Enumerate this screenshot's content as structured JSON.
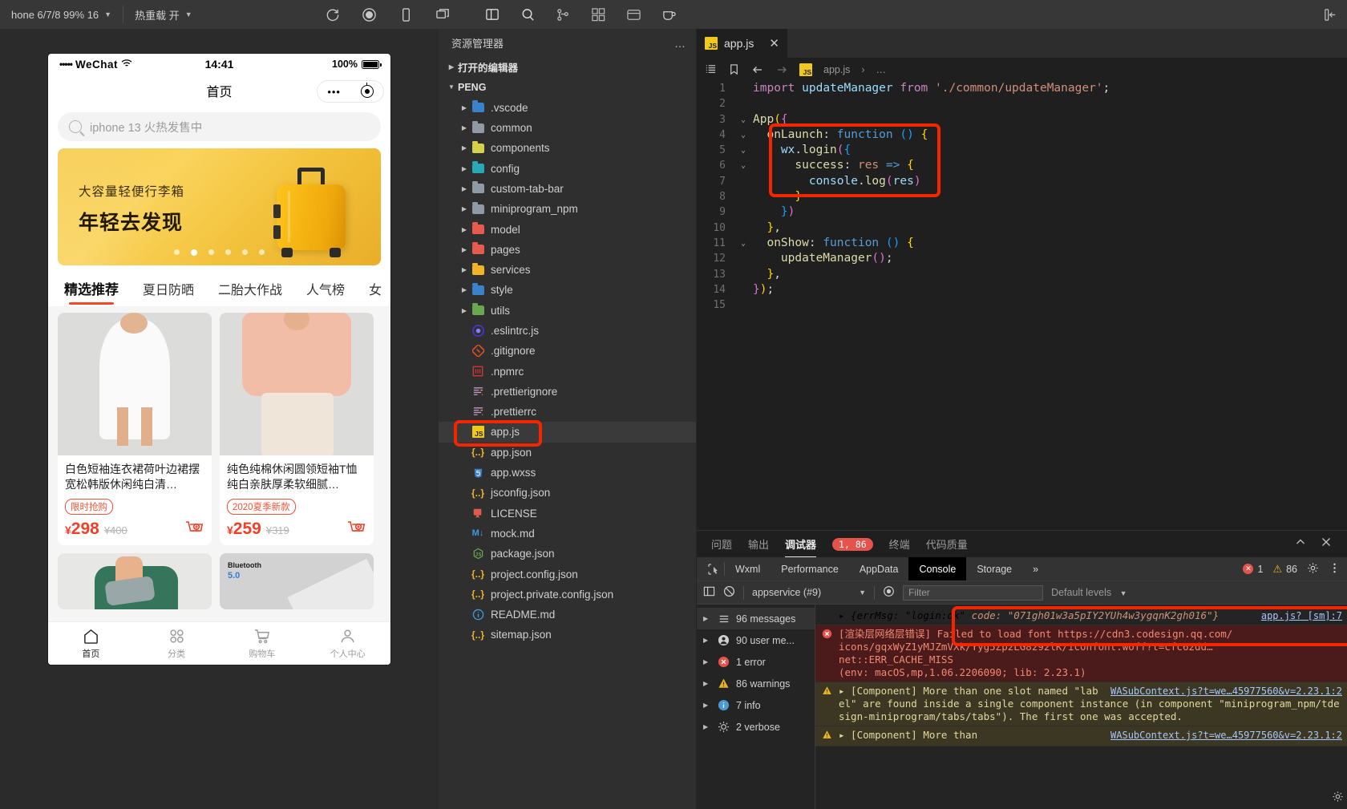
{
  "toolbar": {
    "device_label": "hone 6/7/8 99% 16",
    "hotreload_label": "热重载 开",
    "icons": [
      "refresh-icon",
      "record-icon",
      "phone-icon",
      "copy-window-icon",
      "split-layout-icon",
      "search-icon",
      "source-control-icon",
      "extensions-icon",
      "cloud-icon",
      "coffee-icon",
      "collapse-sidebar-icon"
    ]
  },
  "simulator": {
    "status_bar": {
      "carrier_dots": "•••••",
      "carrier": "WeChat",
      "wifi": "wifi-icon",
      "time": "14:41",
      "battery_pct": "100%"
    },
    "nav_title": "首页",
    "capsule": {
      "more": "•••",
      "target": "target-icon"
    },
    "search_placeholder": "iphone 13 火热发售中",
    "banner": {
      "subtitle": "大容量轻便行李箱",
      "title": "年轻去发现",
      "dot_count": 6,
      "active_dot": 1
    },
    "tabs": [
      {
        "label": "精选推荐",
        "active": true
      },
      {
        "label": "夏日防晒",
        "active": false
      },
      {
        "label": "二胎大作战",
        "active": false
      },
      {
        "label": "人气榜",
        "active": false
      },
      {
        "label": "女",
        "active": false
      }
    ],
    "products": [
      {
        "title": "白色短袖连衣裙荷叶边裙摆宽松韩版休闲纯白清…",
        "badge": "限时抢购",
        "price": "298",
        "old_price": "¥400",
        "currency": "¥"
      },
      {
        "title": "纯色纯棉休闲圆领短袖T恤纯白亲肤厚柔软细腻…",
        "badge": "2020夏季新款",
        "price": "259",
        "old_price": "¥319",
        "currency": "¥"
      }
    ],
    "second_row": {
      "bluetooth_label": "Bluetooth",
      "bluetooth_version": "5.0"
    },
    "tabbar": [
      {
        "label": "首页",
        "icon": "home-icon",
        "active": true
      },
      {
        "label": "分类",
        "icon": "grid-icon",
        "active": false
      },
      {
        "label": "购物车",
        "icon": "cart-icon",
        "active": false
      },
      {
        "label": "个人中心",
        "icon": "user-icon",
        "active": false
      }
    ]
  },
  "explorer": {
    "title": "资源管理器",
    "more": "…",
    "sections": [
      {
        "label": "打开的编辑器",
        "expanded": false
      },
      {
        "label": "PENG",
        "expanded": true
      }
    ],
    "items": [
      {
        "name": ".vscode",
        "type": "folder",
        "icon": "vscode-folder-icon",
        "color": "#3b82cd",
        "expandable": true,
        "selected": false
      },
      {
        "name": "common",
        "type": "folder",
        "icon": "folder-icon",
        "color": "#8f9aa3",
        "expandable": true,
        "selected": false
      },
      {
        "name": "components",
        "type": "folder",
        "icon": "components-folder-icon",
        "color": "#d6d14a",
        "expandable": true,
        "selected": false
      },
      {
        "name": "config",
        "type": "folder",
        "icon": "config-folder-icon",
        "color": "#2aa8b5",
        "expandable": true,
        "selected": false
      },
      {
        "name": "custom-tab-bar",
        "type": "folder",
        "icon": "folder-icon",
        "color": "#8f9aa3",
        "expandable": true,
        "selected": false
      },
      {
        "name": "miniprogram_npm",
        "type": "folder",
        "icon": "folder-icon",
        "color": "#8f9aa3",
        "expandable": true,
        "selected": false
      },
      {
        "name": "model",
        "type": "folder",
        "icon": "model-folder-icon",
        "color": "#e55b4d",
        "expandable": true,
        "selected": false
      },
      {
        "name": "pages",
        "type": "folder",
        "icon": "pages-folder-icon",
        "color": "#e55b4d",
        "expandable": true,
        "selected": false
      },
      {
        "name": "services",
        "type": "folder",
        "icon": "services-folder-icon",
        "color": "#f0b429",
        "expandable": true,
        "selected": false
      },
      {
        "name": "style",
        "type": "folder",
        "icon": "style-folder-icon",
        "color": "#3b82cd",
        "expandable": true,
        "selected": false
      },
      {
        "name": "utils",
        "type": "folder",
        "icon": "utils-folder-icon",
        "color": "#6aa84f",
        "expandable": true,
        "selected": false
      },
      {
        "name": ".eslintrc.js",
        "type": "file",
        "icon": "eslint-icon",
        "color": "#4b32c3",
        "expandable": false,
        "selected": false
      },
      {
        "name": ".gitignore",
        "type": "file",
        "icon": "git-icon",
        "color": "#e8521f",
        "expandable": false,
        "selected": false
      },
      {
        "name": ".npmrc",
        "type": "file",
        "icon": "npm-icon",
        "color": "#cb3837",
        "expandable": false,
        "selected": false
      },
      {
        "name": ".prettierignore",
        "type": "file",
        "icon": "prettier-icon",
        "color": "#c596c7",
        "expandable": false,
        "selected": false
      },
      {
        "name": ".prettierrc",
        "type": "file",
        "icon": "prettier-icon",
        "color": "#c596c7",
        "expandable": false,
        "selected": false
      },
      {
        "name": "app.js",
        "type": "file",
        "icon": "js-icon",
        "color": "#f2c91b",
        "expandable": false,
        "selected": true,
        "highlighted": true
      },
      {
        "name": "app.json",
        "type": "file",
        "icon": "json-icon",
        "color": "#f0b429",
        "expandable": false,
        "selected": false
      },
      {
        "name": "app.wxss",
        "type": "file",
        "icon": "css-icon",
        "color": "#3b82cd",
        "expandable": false,
        "selected": false
      },
      {
        "name": "jsconfig.json",
        "type": "file",
        "icon": "json-icon",
        "color": "#f0b429",
        "expandable": false,
        "selected": false
      },
      {
        "name": "LICENSE",
        "type": "file",
        "icon": "license-icon",
        "color": "#e05b49",
        "expandable": false,
        "selected": false
      },
      {
        "name": "mock.md",
        "type": "file",
        "icon": "markdown-icon",
        "color": "#3b9ddd",
        "expandable": false,
        "selected": false
      },
      {
        "name": "package.json",
        "type": "file",
        "icon": "nodejs-icon",
        "color": "#6aa84f",
        "expandable": false,
        "selected": false
      },
      {
        "name": "project.config.json",
        "type": "file",
        "icon": "json-icon",
        "color": "#f0b429",
        "expandable": false,
        "selected": false
      },
      {
        "name": "project.private.config.json",
        "type": "file",
        "icon": "json-icon",
        "color": "#f0b429",
        "expandable": false,
        "selected": false
      },
      {
        "name": "README.md",
        "type": "file",
        "icon": "info-icon",
        "color": "#3b9ddd",
        "expandable": false,
        "selected": false
      },
      {
        "name": "sitemap.json",
        "type": "file",
        "icon": "json-icon",
        "color": "#f0b429",
        "expandable": false,
        "selected": false
      }
    ]
  },
  "editor": {
    "tab": {
      "label": "app.js",
      "icon": "js-icon",
      "close": "✕"
    },
    "breadcrumb": {
      "file": "app.js",
      "rest": "…",
      "sep": "›"
    },
    "lines": [
      {
        "n": "1",
        "fold": "",
        "tokens": [
          {
            "t": "import",
            "c": "k-import"
          },
          {
            "t": " ",
            "c": "k-plain"
          },
          {
            "t": "updateManager",
            "c": "k-var"
          },
          {
            "t": " ",
            "c": "k-plain"
          },
          {
            "t": "from",
            "c": "k-import"
          },
          {
            "t": " ",
            "c": "k-plain"
          },
          {
            "t": "'./common/updateManager'",
            "c": "k-str"
          },
          {
            "t": ";",
            "c": "k-plain"
          }
        ]
      },
      {
        "n": "2",
        "fold": "",
        "tokens": []
      },
      {
        "n": "3",
        "fold": "v",
        "tokens": [
          {
            "t": "App",
            "c": "k-prop"
          },
          {
            "t": "(",
            "c": "k-par"
          },
          {
            "t": "{",
            "c": "k-par2"
          }
        ]
      },
      {
        "n": "4",
        "fold": "v",
        "tokens": [
          {
            "t": "  onLaunch",
            "c": "k-prop"
          },
          {
            "t": ": ",
            "c": "k-plain"
          },
          {
            "t": "function",
            "c": "k-kw"
          },
          {
            "t": " ",
            "c": "k-plain"
          },
          {
            "t": "()",
            "c": "k-par3"
          },
          {
            "t": " ",
            "c": "k-plain"
          },
          {
            "t": "{",
            "c": "k-par"
          }
        ]
      },
      {
        "n": "5",
        "fold": "v",
        "tokens": [
          {
            "t": "    wx",
            "c": "k-var"
          },
          {
            "t": ".",
            "c": "k-plain"
          },
          {
            "t": "login",
            "c": "k-prop"
          },
          {
            "t": "(",
            "c": "k-par2"
          },
          {
            "t": "{",
            "c": "k-par3"
          }
        ]
      },
      {
        "n": "6",
        "fold": "v",
        "tokens": [
          {
            "t": "      success",
            "c": "k-prop"
          },
          {
            "t": ": ",
            "c": "k-plain"
          },
          {
            "t": "res",
            "c": "k-orange"
          },
          {
            "t": " ",
            "c": "k-plain"
          },
          {
            "t": "=>",
            "c": "k-kw"
          },
          {
            "t": " ",
            "c": "k-plain"
          },
          {
            "t": "{",
            "c": "k-par"
          }
        ]
      },
      {
        "n": "7",
        "fold": "",
        "tokens": [
          {
            "t": "        console",
            "c": "k-var"
          },
          {
            "t": ".",
            "c": "k-plain"
          },
          {
            "t": "log",
            "c": "k-prop"
          },
          {
            "t": "(",
            "c": "k-par2"
          },
          {
            "t": "res",
            "c": "k-var"
          },
          {
            "t": ")",
            "c": "k-par2"
          }
        ]
      },
      {
        "n": "8",
        "fold": "",
        "tokens": [
          {
            "t": "      }",
            "c": "k-par"
          }
        ]
      },
      {
        "n": "9",
        "fold": "",
        "tokens": [
          {
            "t": "    }",
            "c": "k-par3"
          },
          {
            "t": ")",
            "c": "k-par2"
          }
        ]
      },
      {
        "n": "10",
        "fold": "",
        "tokens": [
          {
            "t": "  }",
            "c": "k-par"
          },
          {
            "t": ",",
            "c": "k-plain"
          }
        ]
      },
      {
        "n": "11",
        "fold": "v",
        "tokens": [
          {
            "t": "  onShow",
            "c": "k-prop"
          },
          {
            "t": ": ",
            "c": "k-plain"
          },
          {
            "t": "function",
            "c": "k-kw"
          },
          {
            "t": " ",
            "c": "k-plain"
          },
          {
            "t": "()",
            "c": "k-par3"
          },
          {
            "t": " ",
            "c": "k-plain"
          },
          {
            "t": "{",
            "c": "k-par"
          }
        ]
      },
      {
        "n": "12",
        "fold": "",
        "tokens": [
          {
            "t": "    updateManager",
            "c": "k-prop"
          },
          {
            "t": "(",
            "c": "k-par2"
          },
          {
            "t": ")",
            "c": "k-par2"
          },
          {
            "t": ";",
            "c": "k-plain"
          }
        ]
      },
      {
        "n": "13",
        "fold": "",
        "tokens": [
          {
            "t": "  }",
            "c": "k-par"
          },
          {
            "t": ",",
            "c": "k-plain"
          }
        ]
      },
      {
        "n": "14",
        "fold": "",
        "tokens": [
          {
            "t": "}",
            "c": "k-par2"
          },
          {
            "t": ")",
            "c": "k-par"
          },
          {
            "t": ";",
            "c": "k-plain"
          }
        ]
      },
      {
        "n": "15",
        "fold": "",
        "tokens": []
      }
    ]
  },
  "panel": {
    "tabs": [
      {
        "label": "问题",
        "active": false,
        "badge": null
      },
      {
        "label": "输出",
        "active": false,
        "badge": null
      },
      {
        "label": "调试器",
        "active": true,
        "badge": "1, 86"
      },
      {
        "label": "终端",
        "active": false,
        "badge": null
      },
      {
        "label": "代码质量",
        "active": false,
        "badge": null
      }
    ],
    "collapse_icon": "chevron-up-icon",
    "close_icon": "close-icon"
  },
  "devtools": {
    "tabs": [
      {
        "label": "Wxml",
        "active": false
      },
      {
        "label": "Performance",
        "active": false
      },
      {
        "label": "AppData",
        "active": false
      },
      {
        "label": "Console",
        "active": true
      },
      {
        "label": "Storage",
        "active": false
      },
      {
        "label": "»",
        "active": false
      }
    ],
    "inspect_icon": "inspect-icon",
    "error_count": "1",
    "warning_count": "86",
    "settings_icon": "gear-icon",
    "kebab_icon": "more-vertical-icon",
    "toolbar": {
      "sidebar_icon": "panel-left-icon",
      "clear_icon": "clear-console-icon",
      "context": "appservice (#9)",
      "eye_icon": "eye-icon",
      "filter_placeholder": "Filter",
      "levels": "Default levels"
    },
    "summary": [
      {
        "label": "96 messages",
        "icon": "list-icon",
        "selected": true
      },
      {
        "label": "90 user me...",
        "icon": "user-icon",
        "selected": false
      },
      {
        "label": "1 error",
        "icon": "error-icon",
        "selected": false
      },
      {
        "label": "86 warnings",
        "icon": "warning-icon",
        "selected": false
      },
      {
        "label": "7 info",
        "icon": "info-icon",
        "selected": false
      },
      {
        "label": "2 verbose",
        "icon": "verbose-icon",
        "selected": false
      }
    ],
    "messages": [
      {
        "level": "log",
        "source": "app.js? [sm]:7",
        "parts": [
          {
            "text": "▸ {errMsg: \"login:ok\"",
            "style": "italic"
          },
          {
            "text": " code: \"071gh01w3a5pIY2YUh4w3ygqnK2gh016\"}",
            "style": "italic-code"
          }
        ],
        "highlighted": true
      },
      {
        "level": "error",
        "text": "[渲染层网络层错误] Failed to load font https://cdn3.codesign.qq.com/\nicons/gqxWyZ1yMJZmVXk/Yyg5Zp2LG8292lK/iconfont.woff?t=cfc62dd…\nnet::ERR_CACHE_MISS\n(env: macOS,mp,1.06.2206090; lib: 2.23.1)",
        "link": "https://cdn3.codesign.qq.com/icons/gqxWyZ1yMJZmVXk/Yyg5Zp2LG8292lK/iconfont.woff?t=cfc62dd…"
      },
      {
        "level": "warning",
        "text": "▸ [Component] More than one slot named \"label\" are found inside a single component instance (in component \"miniprogram_npm/tdesign-miniprogram/tabs/tabs\"). The first one was accepted.",
        "source": "WASubContext.js?t=we…45977560&v=2.23.1:2"
      },
      {
        "level": "warning",
        "text": "▸ [Component] More than",
        "source": "WASubContext.js?t=we…45977560&v=2.23.1:2"
      }
    ]
  }
}
